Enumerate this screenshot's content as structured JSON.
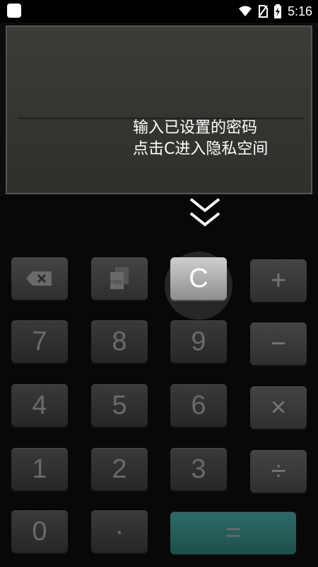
{
  "status_bar": {
    "time": "5:16",
    "icons": [
      "wifi-icon",
      "no-sim-icon",
      "battery-charging-icon"
    ]
  },
  "hint": {
    "line1": "输入已设置的密码",
    "line2": "点击C进入隐私空间"
  },
  "keys": {
    "backspace": "",
    "copy": "copy",
    "clear": "C",
    "plus": "+",
    "seven": "7",
    "eight": "8",
    "nine": "9",
    "minus": "−",
    "four": "4",
    "five": "5",
    "six": "6",
    "multiply": "×",
    "one": "1",
    "two": "2",
    "three": "3",
    "divide": "÷",
    "zero": "0",
    "dot": "·",
    "equals": "="
  },
  "colors": {
    "equals_key": "#2d6b68",
    "display_bg": "#3b3b37"
  }
}
